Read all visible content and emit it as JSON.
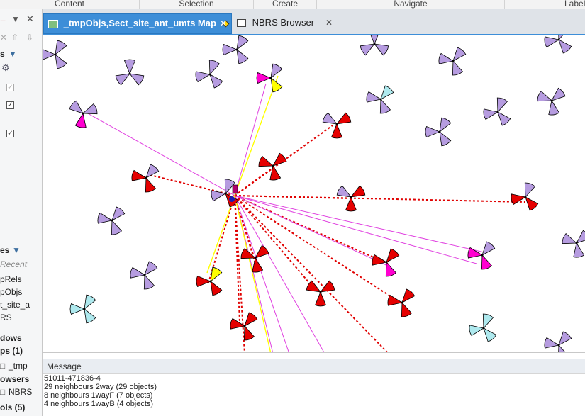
{
  "ribbon": {
    "groups": [
      "Content",
      "Selection",
      "Create",
      "Navigate",
      "Label"
    ]
  },
  "left_panel": {
    "items": [
      {
        "label": "s",
        "key": "s1"
      },
      {
        "label": "es",
        "key": "es"
      },
      {
        "label": "Recent",
        "key": "recent"
      },
      {
        "label": "pRels",
        "key": "prels"
      },
      {
        "label": "pObjs",
        "key": "pobjs"
      },
      {
        "label": "t_site_a",
        "key": "site"
      },
      {
        "label": "RS",
        "key": "rs"
      },
      {
        "label": "dows",
        "key": "dows"
      },
      {
        "label": "ps (1)",
        "key": "ps"
      },
      {
        "label": "_tmp",
        "key": "tmp"
      },
      {
        "label": "owsers",
        "key": "owsers"
      },
      {
        "label": "NBRS",
        "key": "nbrs"
      },
      {
        "label": "ols (5)",
        "key": "ols"
      }
    ]
  },
  "tabs": [
    {
      "label": "_tmpObjs,Sect_site_ant_umts Map",
      "active": true,
      "icon": "map-icon"
    },
    {
      "label": "NBRS Browser",
      "active": false,
      "icon": "grid-icon"
    }
  ],
  "colors": {
    "accent": "#3d8ed8",
    "sector_purple": "#b69ce0",
    "sector_red": "#e50000",
    "sector_magenta": "#ff00d0",
    "sector_yellow": "#ffff00",
    "sector_cyan": "#aee9ee",
    "link_red": "#e00000",
    "link_magenta": "#e040e0",
    "link_yellow": "#ffff00"
  },
  "messages": {
    "header": "Message",
    "lines": [
      "51011-471836-4",
      "29 neighbours 2way (29 objects)",
      "8 neighbours 1wayF (7 objects)",
      "4 neighbours 1wayB (4 objects)"
    ]
  }
}
